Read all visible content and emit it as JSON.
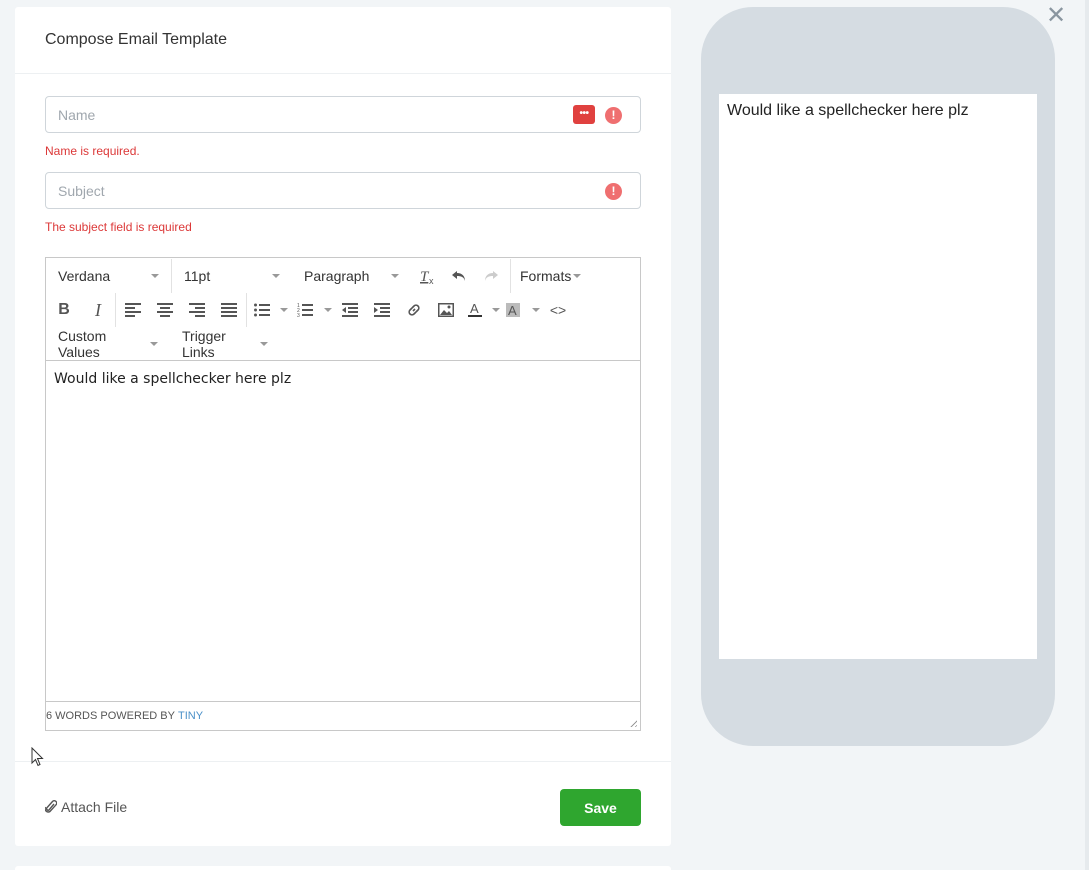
{
  "header": {
    "title": "Compose Email Template"
  },
  "form": {
    "name": {
      "placeholder": "Name",
      "value": "",
      "error": "Name is required."
    },
    "subject": {
      "placeholder": "Subject",
      "value": "",
      "error": "The subject field is required"
    }
  },
  "editor": {
    "font_family": "Verdana",
    "font_size": "11pt",
    "block_format": "Paragraph",
    "formats_label": "Formats",
    "custom_values_label": "Custom Values",
    "trigger_links_label": "Trigger Links",
    "content": "Would like a spellchecker here plz",
    "status_words": "6 WORDS POWERED BY",
    "status_brand": "TINY"
  },
  "footer": {
    "attach_label": "Attach File",
    "save_label": "Save"
  },
  "preview": {
    "content": "Would like a spellchecker here plz"
  },
  "colors": {
    "save_green": "#2fa62f",
    "error_red": "#dc3838",
    "phone_frame": "#d5dce2"
  }
}
